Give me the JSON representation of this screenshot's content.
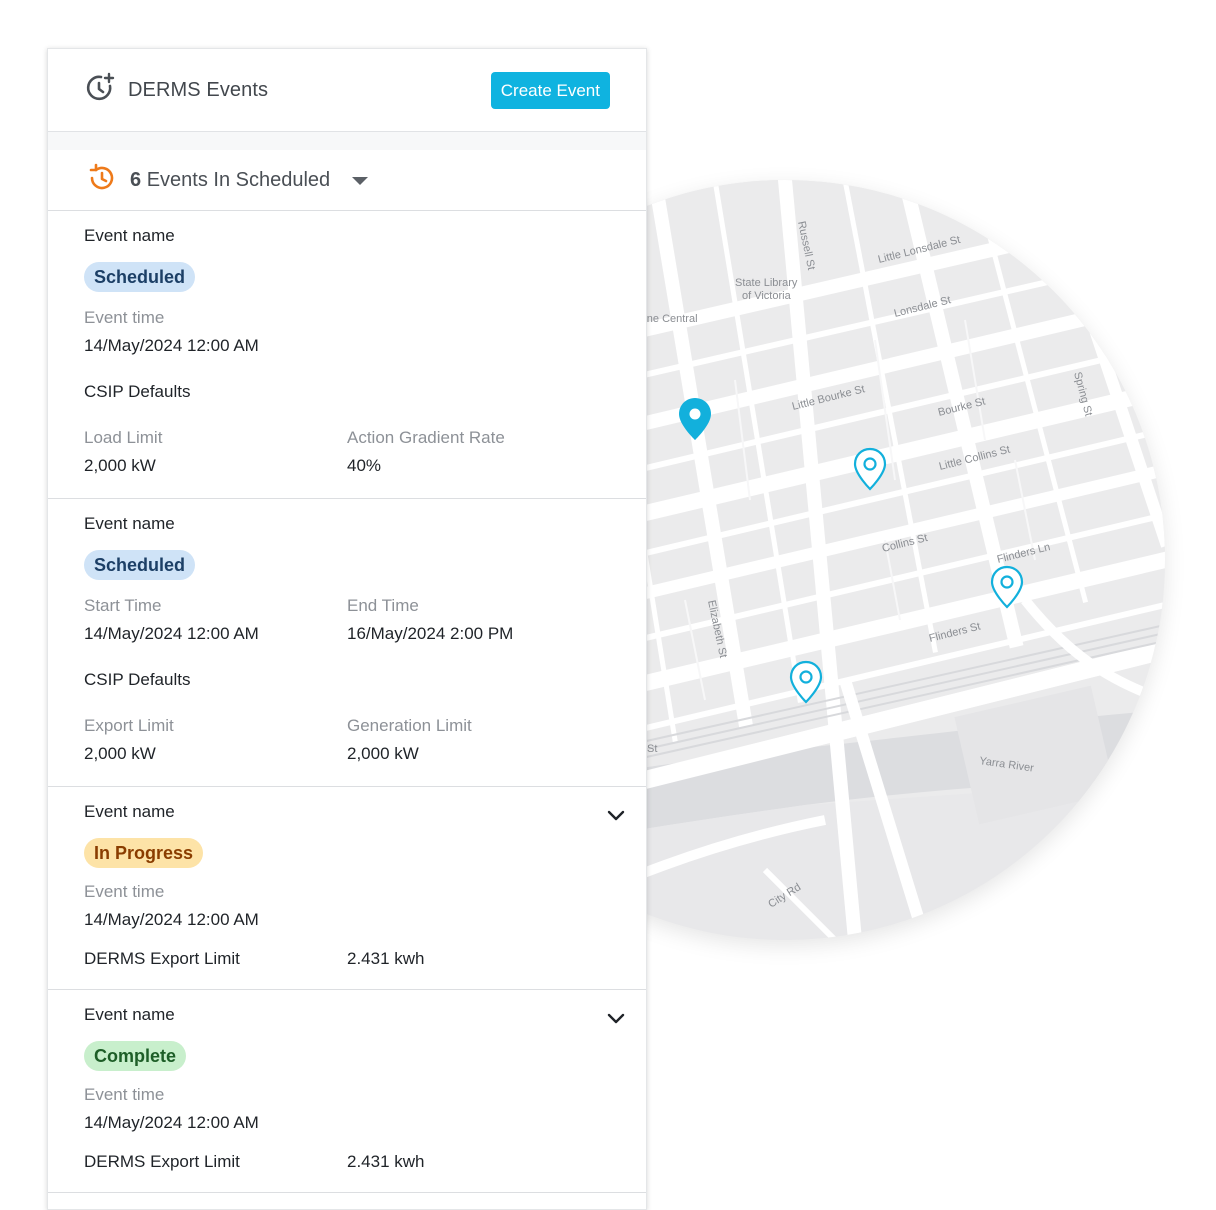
{
  "header": {
    "title": "DERMS Events",
    "create_button": "Create Event",
    "icon": "clock-plus-icon"
  },
  "filter": {
    "count": "6",
    "label": "Events In Scheduled",
    "icon": "clock-history-icon"
  },
  "cards": [
    {
      "name": "Event name",
      "status": "Scheduled",
      "time_label": "Event time",
      "time_value": "14/May/2024 12:00 AM",
      "section": "CSIP Defaults",
      "fields": [
        {
          "label": "Load Limit",
          "value": "2,000 kW"
        },
        {
          "label": "Action Gradient Rate",
          "value": "40%"
        }
      ]
    },
    {
      "name": "Event name",
      "status": "Scheduled",
      "start_label": "Start Time",
      "start_value": "14/May/2024 12:00 AM",
      "end_label": "End Time",
      "end_value": "16/May/2024 2:00 PM",
      "section": "CSIP Defaults",
      "fields": [
        {
          "label": "Export Limit",
          "value": "2,000 kW"
        },
        {
          "label": "Generation Limit",
          "value": "2,000 kW"
        }
      ]
    },
    {
      "name": "Event name",
      "status": "In Progress",
      "time_label": "Event time",
      "time_value": "14/May/2024 12:00 AM",
      "metric_label": "DERMS Export Limit",
      "metric_value": "2.431 kwh"
    },
    {
      "name": "Event name",
      "status": "Complete",
      "time_label": "Event time",
      "time_value": "14/May/2024 12:00 AM",
      "metric_label": "DERMS Export Limit",
      "metric_value": "2.431 kwh"
    }
  ],
  "map": {
    "streets": {
      "russell": "Russell St",
      "little_lonsdale": "Little Lonsdale St",
      "lonsdale": "Lonsdale St",
      "library": "State Library",
      "library2": "of Victoria",
      "central": "urne Central",
      "little_bourke": "Little Bourke St",
      "bourke": "Bourke St",
      "spring": "Spring St",
      "little_collins": "Little Collins St",
      "collins": "Collins St",
      "flinders_ln": "Flinders Ln",
      "flinders": "Flinders St",
      "elizabeth": "Elizabeth St",
      "st_frag": "St",
      "yarra": "Yarra River",
      "city_rd": "City Rd"
    },
    "pin_color": "#12b0dc"
  }
}
